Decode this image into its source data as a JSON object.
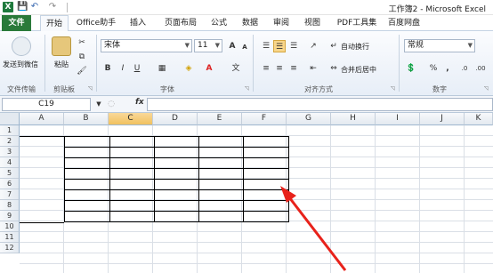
{
  "window": {
    "title": "工作簿2 - Microsoft Excel"
  },
  "quick_access": {
    "logo": "X",
    "save": "💾",
    "undo": "↶",
    "redo": "↷"
  },
  "tabs": [
    "文件",
    "开始",
    "Office助手",
    "插入",
    "页面布局",
    "公式",
    "数据",
    "审阅",
    "视图",
    "PDF工具集",
    "百度网盘"
  ],
  "ribbon": {
    "send_to_wechat": "发送到微信",
    "paste": "粘贴",
    "font_name": "宋体",
    "font_size": "11",
    "wrap_text": "自动换行",
    "merge_center": "合并后居中",
    "number_format": "常规",
    "groups": {
      "file_transfer": "文件传输",
      "clipboard": "剪贴板",
      "font": "字体",
      "alignment": "对齐方式",
      "number": "数字"
    },
    "bold": "B",
    "italic": "I",
    "underline": "U",
    "grow_font": "A",
    "shrink_font": "A",
    "percent": "%",
    "comma": ","
  },
  "formula_bar": {
    "name_box": "C19",
    "fx": "fx",
    "value": ""
  },
  "columns": [
    "A",
    "B",
    "C",
    "D",
    "E",
    "F",
    "G",
    "H",
    "I",
    "J",
    "K"
  ],
  "selected_column": "C",
  "rows": [
    "1",
    "2",
    "3",
    "4",
    "5",
    "6",
    "7",
    "8",
    "9",
    "10",
    "11",
    "12"
  ],
  "colors": {
    "file_tab": "#2a7a3a",
    "accent_selection": "#f1c15f",
    "annotation_arrow": "#e8221b"
  }
}
